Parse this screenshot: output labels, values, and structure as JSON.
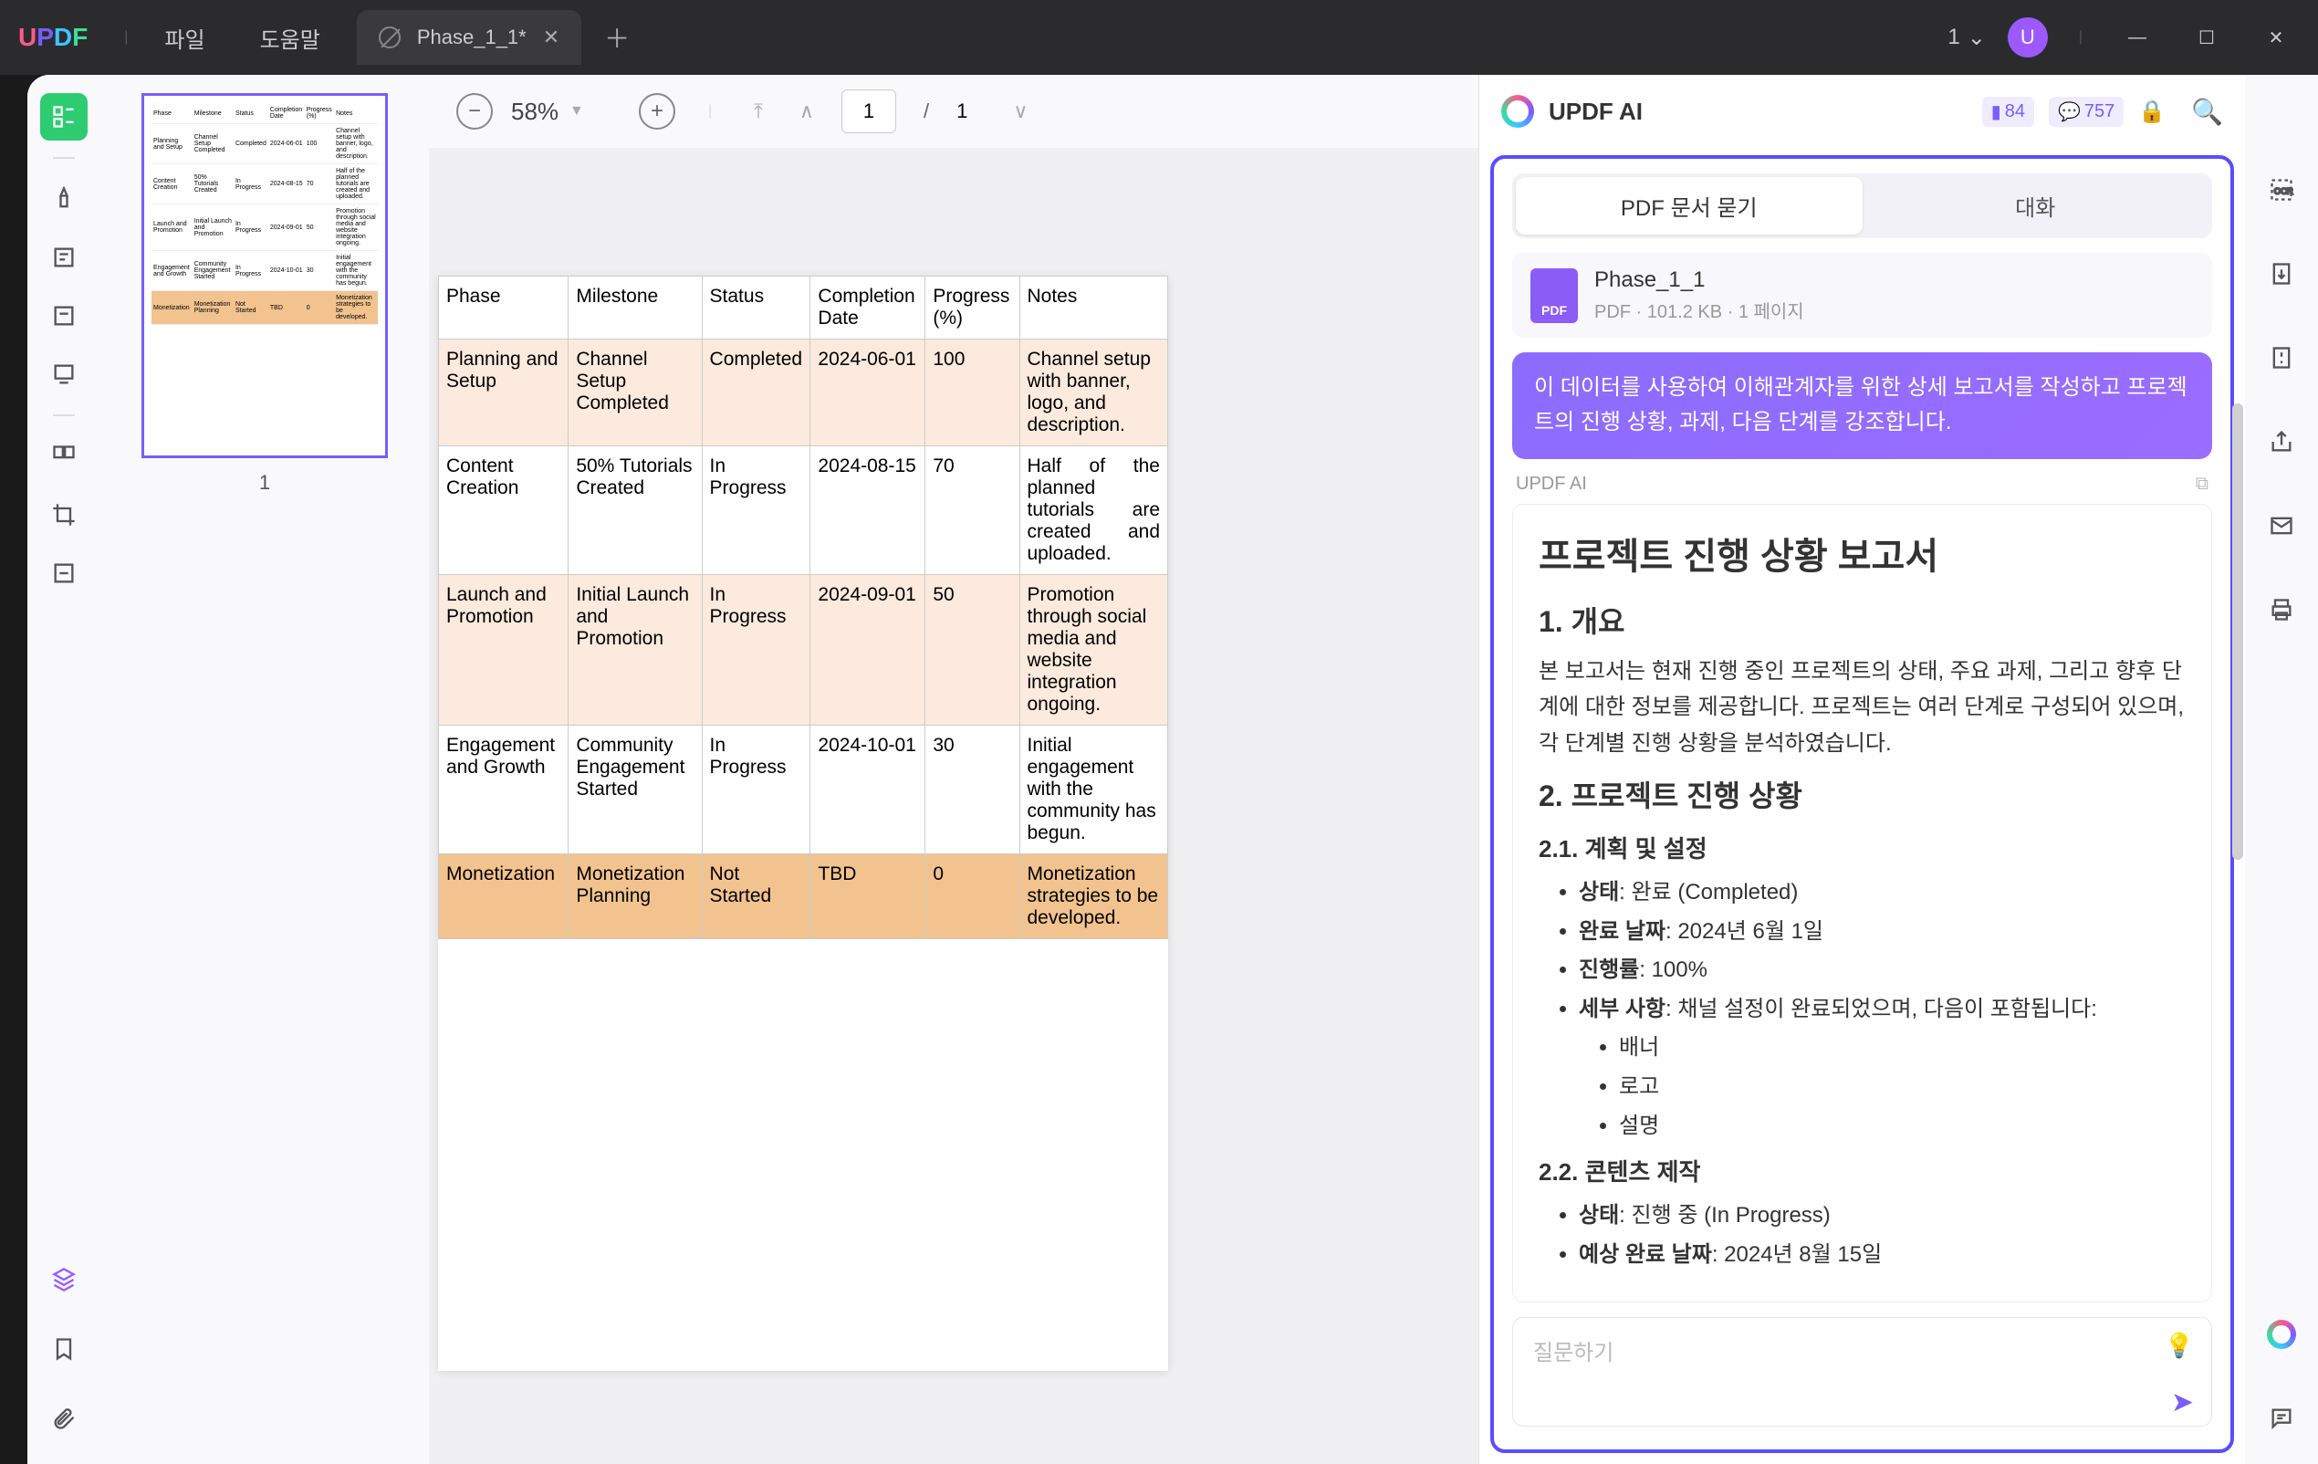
{
  "titlebar": {
    "menu_file": "파일",
    "menu_help": "도움말",
    "tab_name": "Phase_1_1*",
    "window_count": "1",
    "avatar_initial": "U"
  },
  "thumb": {
    "page_num": "1"
  },
  "toolbar": {
    "zoom": "58%",
    "page_current": "1",
    "page_total": "1"
  },
  "pdf_table": {
    "headers": [
      "Phase",
      "Milestone",
      "Status",
      "Completion Date",
      "Progress (%)",
      "Notes"
    ],
    "rows": [
      {
        "phase": "Planning and Setup",
        "milestone": "Channel Setup Completed",
        "status": "Completed",
        "date": "2024-06-01",
        "progress": "100",
        "notes": "Channel setup with banner, logo, and description."
      },
      {
        "phase": "Content Creation",
        "milestone": "50% Tutorials Created",
        "status": "In Progress",
        "date": "2024-08-15",
        "progress": "70",
        "notes": "Half of the planned tutorials are created and uploaded."
      },
      {
        "phase": "Launch and Promotion",
        "milestone": "Initial Launch and Promotion",
        "status": "In Progress",
        "date": "2024-09-01",
        "progress": "50",
        "notes": "Promotion through social media and website integration ongoing."
      },
      {
        "phase": "Engagement and Growth",
        "milestone": "Community Engagement Started",
        "status": "In Progress",
        "date": "2024-10-01",
        "progress": "30",
        "notes": "Initial engagement with the community has begun."
      },
      {
        "phase": "Monetization",
        "milestone": "Monetization Planning",
        "status": "Not Started",
        "date": "TBD",
        "progress": "0",
        "notes": "Monetization strategies to be developed."
      }
    ]
  },
  "ai": {
    "title": "UPDF AI",
    "stat1": "84",
    "stat2": "757",
    "tab_ask": "PDF 문서 묻기",
    "tab_chat": "대화",
    "file_name": "Phase_1_1",
    "file_meta": "PDF · 101.2 KB · 1 페이지",
    "user_message": "이 데이터를 사용하여 이해관계자를 위한 상세 보고서를 작성하고 프로젝트의 진행 상황, 과제, 다음 단계를 강조합니다.",
    "label": "UPDF AI",
    "response": {
      "h1": "프로젝트 진행 상황 보고서",
      "h2_1": "1. 개요",
      "p1": "본 보고서는 현재 진행 중인 프로젝트의 상태, 주요 과제, 그리고 향후 단계에 대한 정보를 제공합니다. 프로젝트는 여러 단계로 구성되어 있으며, 각 단계별 진행 상황을 분석하였습니다.",
      "h2_2": "2. 프로젝트 진행 상황",
      "h3_1": "2.1. 계획 및 설정",
      "li_1_1_label": "상태",
      "li_1_1_val": ": 완료 (Completed)",
      "li_1_2_label": "완료 날짜",
      "li_1_2_val": ": 2024년 6월 1일",
      "li_1_3_label": "진행률",
      "li_1_3_val": ": 100%",
      "li_1_4_label": "세부 사항",
      "li_1_4_val": ": 채널 설정이 완료되었으며, 다음이 포함됩니다:",
      "sub_1": "배너",
      "sub_2": "로고",
      "sub_3": "설명",
      "h3_2": "2.2. 콘텐츠 제작",
      "li_2_1_label": "상태",
      "li_2_1_val": ": 진행 중 (In Progress)",
      "li_2_2_label": "예상 완료 날짜",
      "li_2_2_val": ": 2024년 8월 15일"
    },
    "input_placeholder": "질문하기"
  }
}
